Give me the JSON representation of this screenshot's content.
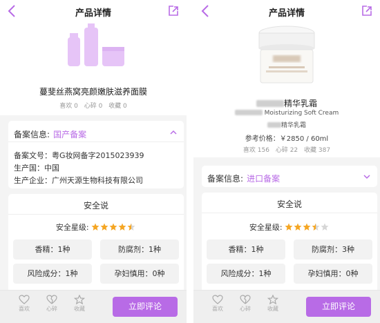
{
  "colors": {
    "accent": "#b86be6",
    "bg": "#f4f4f4",
    "tile": "#f2f2f2",
    "star": "#f5a623"
  },
  "left": {
    "nav_title": "产品详情",
    "product_name": "蔓斐丝燕窝亮颜嫩肤滋养面膜",
    "stats": {
      "like": "喜欢 0",
      "dislike": "心碎 0",
      "fav": "收藏 0"
    },
    "record": {
      "label": "备案信息:",
      "value": "国产备案",
      "rows": [
        "备案文号：粤G妆网备字2015023939",
        "生产国：中国",
        "生产企业：广州天源生物科技有限公司"
      ]
    },
    "safety": {
      "title": "安全说",
      "rating_label": "安全星级:",
      "rating": 4.5,
      "tiles": [
        "香精：1种",
        "防腐剂：1种",
        "风险成分：1种",
        "孕妇慎用：0种"
      ]
    },
    "bottom": {
      "like": "喜欢",
      "dislike": "心碎",
      "fav": "收藏",
      "comment": "立即评论"
    }
  },
  "right": {
    "nav_title": "产品详情",
    "product_name_suffix": "精华乳霜",
    "product_en_suffix": "Moisturizing Soft Cream",
    "brand_suffix": "精华乳霜",
    "price": "参考价格：￥2850 / 60ml",
    "stats": {
      "like": "喜欢 156",
      "dislike": "心碎 22",
      "fav": "收藏 387"
    },
    "record": {
      "label": "备案信息:",
      "value": "进口备案"
    },
    "safety": {
      "title": "安全说",
      "rating_label": "安全星级:",
      "rating": 3.5,
      "tiles": [
        "香精：1种",
        "防腐剂：3种",
        "风险成分：1种",
        "孕妇慎用：0种"
      ]
    },
    "bottom": {
      "like": "喜欢",
      "dislike": "心碎",
      "fav": "收藏",
      "comment": "立即评论"
    }
  }
}
